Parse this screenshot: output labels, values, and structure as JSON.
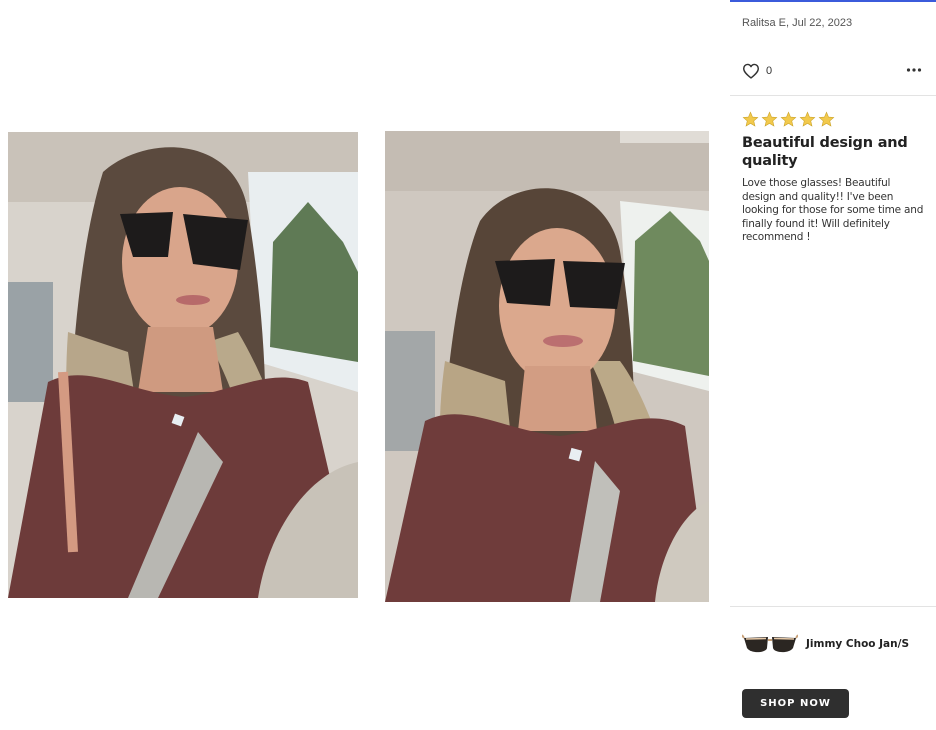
{
  "gallery": {
    "photos": [
      {
        "alt": "",
        "icon": "photo-icon"
      },
      {
        "alt": "",
        "icon": "photo-icon"
      }
    ]
  },
  "review": {
    "reviewer_line": "Ralitsa E, Jul 22, 2023",
    "likes": "0",
    "rating": 5,
    "rating_max": 5,
    "title": "Beautiful design and quality",
    "body": "Love those glasses! Beautiful design and quality!! I've been looking for those for some time and finally found it! Will definitely recommend !"
  },
  "product": {
    "name": "Jimmy Choo Jan/S",
    "shop_label": "SHOP NOW"
  },
  "colors": {
    "accent_bar": "#3b5bdb",
    "star": "#f2c94c",
    "button_bg": "#2f2f2f"
  }
}
